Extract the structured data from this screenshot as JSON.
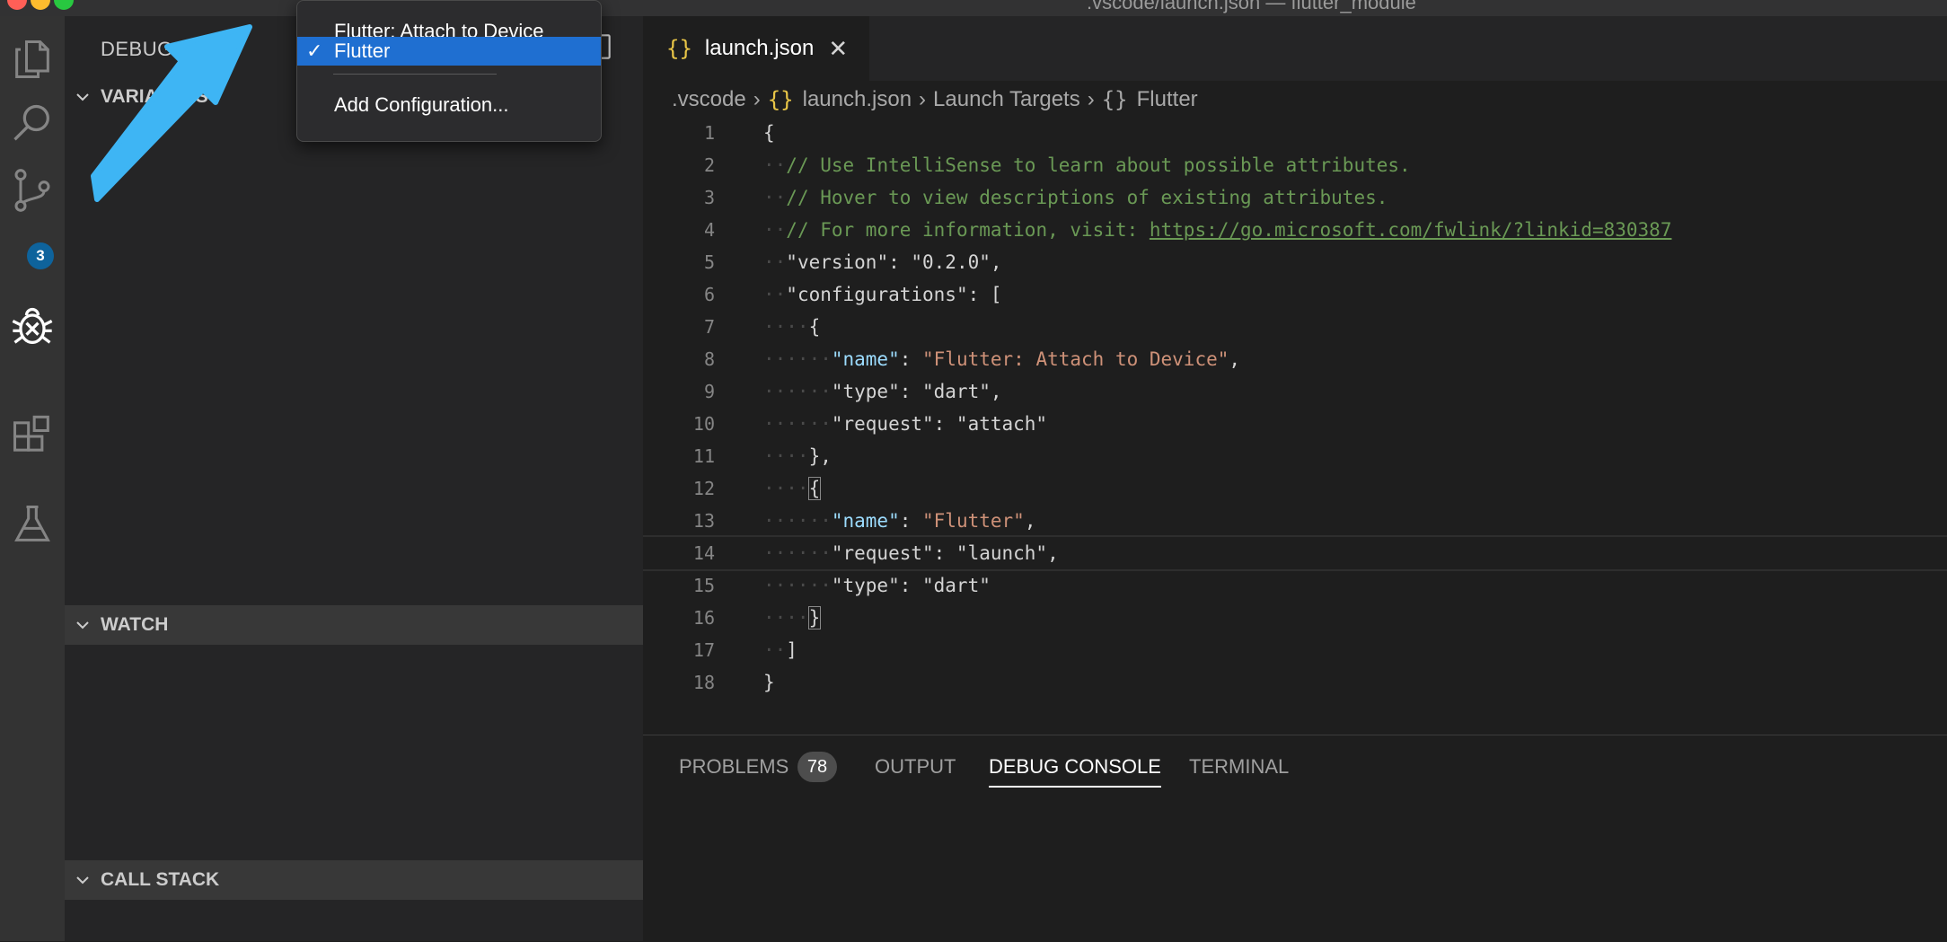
{
  "window": {
    "title": ".vscode/launch.json — flutter_module"
  },
  "activity_bar": {
    "source_control_badge": "3",
    "icons": [
      "files-icon",
      "search-icon",
      "source-control-icon",
      "debug-icon",
      "extensions-icon",
      "testing-flask-icon"
    ]
  },
  "sidebar": {
    "debug_label": "DEBUG",
    "variables_label": "VARIABLES",
    "watch_label": "WATCH",
    "call_stack_label": "CALL STACK"
  },
  "dropdown": {
    "items": [
      {
        "label": "Flutter: Attach to Device",
        "selected": false
      },
      {
        "label": "Flutter",
        "selected": true
      },
      {
        "label": "Add Configuration...",
        "selected": false
      }
    ],
    "check": "✓"
  },
  "editor": {
    "tab_label": "launch.json",
    "tab_braces": "{}",
    "close": "✕",
    "breadcrumb": [
      ".vscode",
      "launch.json",
      "Launch Targets",
      "Flutter"
    ],
    "lines": [
      {
        "n": "1"
      },
      {
        "n": "2"
      },
      {
        "n": "3"
      },
      {
        "n": "4"
      },
      {
        "n": "5"
      },
      {
        "n": "6"
      },
      {
        "n": "7"
      },
      {
        "n": "8"
      },
      {
        "n": "9"
      },
      {
        "n": "10"
      },
      {
        "n": "11"
      },
      {
        "n": "12"
      },
      {
        "n": "13"
      },
      {
        "n": "14"
      },
      {
        "n": "15"
      },
      {
        "n": "16"
      },
      {
        "n": "17"
      },
      {
        "n": "18"
      }
    ],
    "code": {
      "open_brace": "{",
      "comment1": "// Use IntelliSense to learn about possible attributes.",
      "comment2": "// Hover to view descriptions of existing attributes.",
      "comment3_prefix": "// For more information, visit: ",
      "comment3_link": "https://go.microsoft.com/fwlink/?linkid=830387",
      "version_line": "\"version\": \"0.2.0\",",
      "configurations_line": "\"configurations\": [",
      "obj_open": "{",
      "name_key": "\"name\"",
      "name1_value": "\"Flutter: Attach to Device\"",
      "type1_line": "\"type\": \"dart\",",
      "request1_line": "\"request\": \"attach\"",
      "obj_close_comma": "},",
      "name2_value": "\"Flutter\"",
      "request2_line": "\"request\": \"launch\",",
      "type2_line": "\"type\": \"dart\"",
      "obj_close": "}",
      "array_close": "]",
      "close_brace": "}"
    }
  },
  "panel": {
    "tabs": [
      "PROBLEMS",
      "OUTPUT",
      "DEBUG CONSOLE",
      "TERMINAL"
    ],
    "problems_count": "78",
    "active_tab": "DEBUG CONSOLE"
  },
  "colors": {
    "accent_blue": "#1f6fd1",
    "arrow_blue": "#3eb5f4",
    "comment_green": "#6a9955",
    "key_blue": "#9cdcfe",
    "string_orange": "#ce9178",
    "braces_yellow": "#e8c547"
  }
}
